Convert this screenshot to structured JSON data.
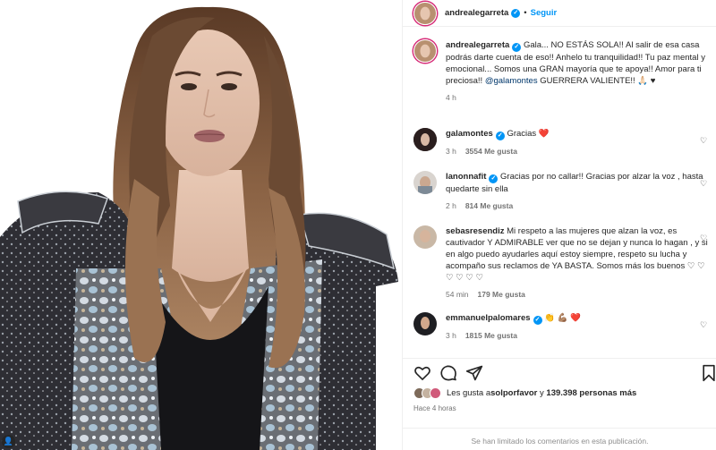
{
  "post": {
    "author": "andrealegarreta",
    "separator": "•",
    "follow_label": "Seguir"
  },
  "caption": {
    "author": "andrealegarreta",
    "text_pre": "Gala... NO ESTÁS SOLA!! Al salir de esa casa podrás darte cuenta de eso!! Anhelo tu tranquilidad!! Tu paz mental y emocional... Somos una GRAN mayoría que te apoya!! Amor para ti preciosa!! ",
    "mention": "@galamontes",
    "text_post": " GUERRERA VALIENTE!! 🙏🏻 ♥",
    "time": "4 h"
  },
  "comments": [
    {
      "user": "galamontes",
      "verified": true,
      "text": "Gracias ❤️",
      "time": "3 h",
      "likes": "3554 Me gusta"
    },
    {
      "user": "lanonnafit",
      "verified": true,
      "text": "Gracias por no callar!! Gracias por alzar la voz , hasta quedarte sin ella",
      "time": "2 h",
      "likes": "814 Me gusta"
    },
    {
      "user": "sebasresendiz",
      "verified": false,
      "text": "Mi respeto a las mujeres que alzan la voz, es cautivador Y ADMIRABLE ver que no se dejan y nunca lo hagan , y si en algo puedo ayudarles aquí estoy siempre, respeto su lucha y acompaño sus reclamos de YA BASTA. Somos más los buenos ♡ ♡ ♡ ♡ ♡ ♡",
      "time": "54 min",
      "likes": "179 Me gusta"
    },
    {
      "user": "emmanuelpalomares",
      "verified": true,
      "text": "👏 💪🏽 ❤️",
      "time": "3 h",
      "likes": "1815 Me gusta"
    }
  ],
  "likes": {
    "prefix": "Les gusta a ",
    "user": "solporfavor",
    "middle": " y ",
    "count": "139.398 personas más"
  },
  "posted_ago": "Hace 4 horas",
  "comments_limited": "Se han limitado los comentarios en esta publicación.",
  "icons": [
    "heart-icon",
    "comment-icon",
    "share-icon",
    "bookmark-icon",
    "verified-icon"
  ],
  "colors": {
    "accent": "#0095f6",
    "text": "#262626",
    "muted": "#737373"
  }
}
